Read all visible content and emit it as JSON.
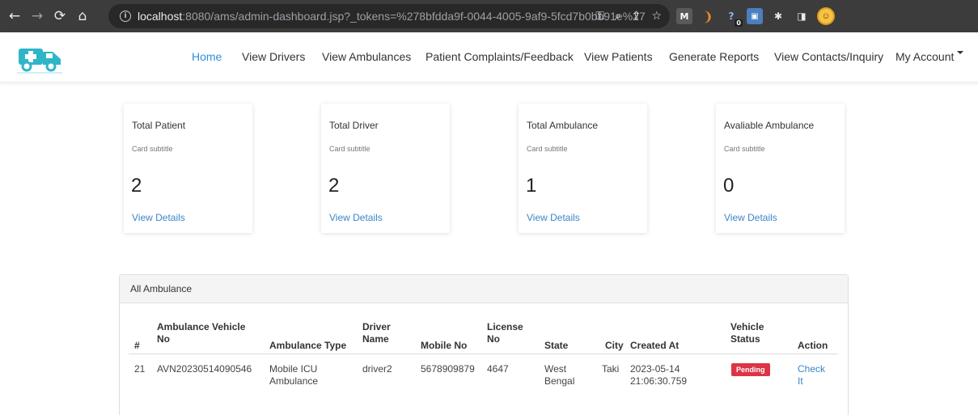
{
  "browser": {
    "url_host": "localhost",
    "url_rest": ":8080/ams/admin-dashboard.jsp?_tokens=%278bfdda9f-0044-4005-9af9-5fcd7b0bb91e%27",
    "icons": [
      "back-icon",
      "forward-icon",
      "reload-icon",
      "home-icon",
      "info-icon",
      "key-icon",
      "zoom-icon",
      "share-icon",
      "star-icon"
    ],
    "extensions": [
      {
        "name": "gmail-extension-icon",
        "glyph": "M"
      },
      {
        "name": "orange-extension-icon",
        "glyph": "❩"
      },
      {
        "name": "pin-extension-icon",
        "glyph": "?"
      },
      {
        "name": "blue-extension-icon",
        "glyph": "📷"
      },
      {
        "name": "puzzle-icon",
        "glyph": "✱"
      },
      {
        "name": "side-panel-icon",
        "glyph": "◨"
      }
    ],
    "badge": "0"
  },
  "nav": {
    "items": [
      {
        "label": "Home",
        "active": true
      },
      {
        "label": "View Drivers"
      },
      {
        "label": "View Ambulances"
      },
      {
        "label": "Patient Complaints/Feedback"
      },
      {
        "label": "View Patients"
      },
      {
        "label": "Generate Reports"
      },
      {
        "label": "View Contacts/Inquiry"
      },
      {
        "label": "My Account"
      }
    ]
  },
  "cards": [
    {
      "title": "Total Patient",
      "subtitle": "Card subtitle",
      "value": "2",
      "link": "View Details"
    },
    {
      "title": "Total Driver",
      "subtitle": "Card subtitle",
      "value": "2",
      "link": "View Details"
    },
    {
      "title": "Total Ambulance",
      "subtitle": "Card subtitle",
      "value": "1",
      "link": "View Details"
    },
    {
      "title": "Avaliable Ambulance",
      "subtitle": "Card subtitle",
      "value": "0",
      "link": "View Details"
    }
  ],
  "table": {
    "title": "All Ambulance",
    "headers": [
      "#",
      "Ambulance Vehicle No",
      "Ambulance Type",
      "Driver Name",
      "Mobile No",
      "License No",
      "State",
      "City",
      "Created At",
      "Vehicle Status",
      "Action"
    ],
    "rows": [
      {
        "id": "21",
        "vehicle_no": "AVN20230514090546",
        "type": "Mobile ICU Ambulance",
        "driver": "driver2",
        "mobile": "5678909879",
        "license": "4647",
        "state": "West Bengal",
        "city": "Taki",
        "created_at": "2023-05-14 21:06:30.759",
        "status": "Pending",
        "action": "Check It"
      }
    ]
  },
  "colors": {
    "accent": "#2f8ed8",
    "link": "#3b86c8",
    "pending": "#dc3545"
  }
}
